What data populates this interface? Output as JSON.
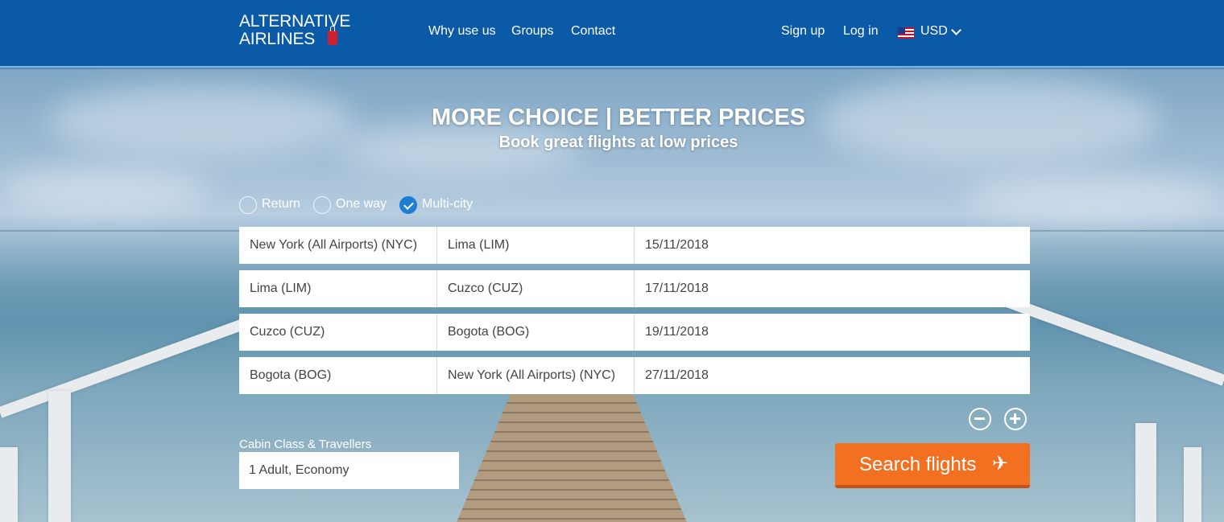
{
  "header": {
    "logo_line1": "ALTERNATIVE",
    "logo_line2": "AIRLINES",
    "nav": [
      "Why use us",
      "Groups",
      "Contact"
    ],
    "signup": "Sign up",
    "login": "Log in",
    "currency": "USD"
  },
  "hero": {
    "title": "MORE CHOICE | BETTER PRICES",
    "subtitle": "Book great flights at low prices"
  },
  "trip_types": [
    {
      "label": "Return",
      "checked": false
    },
    {
      "label": "One way",
      "checked": false
    },
    {
      "label": "Multi-city",
      "checked": true
    }
  ],
  "legs": [
    {
      "from": "New York (All Airports) (NYC)",
      "to": "Lima (LIM)",
      "date": "15/11/2018"
    },
    {
      "from": "Lima (LIM)",
      "to": "Cuzco (CUZ)",
      "date": "17/11/2018"
    },
    {
      "from": "Cuzco (CUZ)",
      "to": "Bogota (BOG)",
      "date": "19/11/2018"
    },
    {
      "from": "Bogota (BOG)",
      "to": "New York (All Airports) (NYC)",
      "date": "27/11/2018"
    }
  ],
  "cabin": {
    "label": "Cabin Class & Travellers",
    "value": "1 Adult, Economy"
  },
  "search": {
    "label": "Search flights",
    "icon": "plane-icon"
  },
  "colors": {
    "header": "#0a5aa8",
    "accent": "#f37021",
    "check": "#1d7fd3"
  }
}
